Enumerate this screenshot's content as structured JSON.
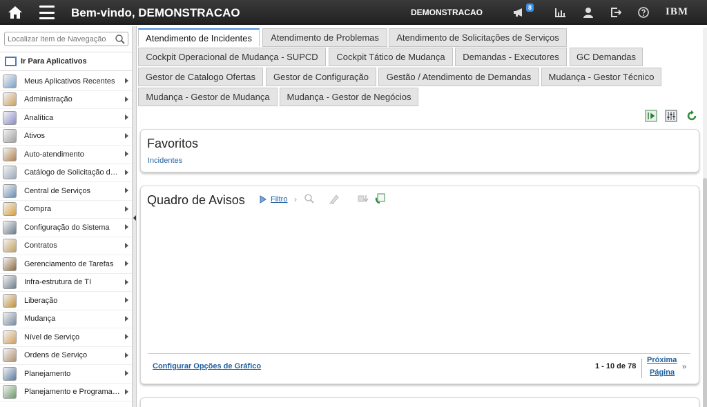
{
  "header": {
    "title": "Bem-vindo, DEMONSTRACAO",
    "user": "DEMONSTRACAO",
    "notification_count": "8",
    "brand": "IBM"
  },
  "leftnav": {
    "search_placeholder": "Localizar Item de Navegação",
    "goto_label": "Ir Para Aplicativos",
    "items": [
      {
        "label": "Meus Aplicativos Recentes",
        "icon": "recent-apps-icon"
      },
      {
        "label": "Administração",
        "icon": "administration-icon"
      },
      {
        "label": "Analítica",
        "icon": "analytics-icon"
      },
      {
        "label": "Ativos",
        "icon": "assets-icon"
      },
      {
        "label": "Auto-atendimento",
        "icon": "self-service-icon"
      },
      {
        "label": "Catálogo de Solicitação de Serviços",
        "icon": "service-catalog-icon"
      },
      {
        "label": "Central de Serviços",
        "icon": "service-desk-icon"
      },
      {
        "label": "Compra",
        "icon": "purchasing-icon"
      },
      {
        "label": "Configuração do Sistema",
        "icon": "system-config-icon"
      },
      {
        "label": "Contratos",
        "icon": "contracts-icon"
      },
      {
        "label": "Gerenciamento de Tarefas",
        "icon": "task-management-icon"
      },
      {
        "label": "Infra-estrutura de TI",
        "icon": "it-infrastructure-icon"
      },
      {
        "label": "Liberação",
        "icon": "release-icon"
      },
      {
        "label": "Mudança",
        "icon": "change-icon"
      },
      {
        "label": "Nível de Serviço",
        "icon": "service-level-icon"
      },
      {
        "label": "Ordens de Serviço",
        "icon": "work-orders-icon"
      },
      {
        "label": "Planejamento",
        "icon": "planning-icon"
      },
      {
        "label": "Planejamento e Programação",
        "icon": "planning-scheduling-icon"
      }
    ]
  },
  "tabs": [
    {
      "label": "Atendimento de Incidentes",
      "active": true
    },
    {
      "label": "Atendimento de Problemas"
    },
    {
      "label": "Atendimento de Solicitações de Serviços"
    },
    {
      "label": "Cockpit Operacional de Mudança - SUPCD"
    },
    {
      "label": "Cockpit Tático de Mudança"
    },
    {
      "label": "Demandas - Executores"
    },
    {
      "label": "GC Demandas"
    },
    {
      "label": "Gestor de Catalogo Ofertas"
    },
    {
      "label": "Gestor de Configuração"
    },
    {
      "label": "Gestão / Atendimento de Demandas"
    },
    {
      "label": "Mudança - Gestor Técnico"
    },
    {
      "label": "Mudança - Gestor de Mudança"
    },
    {
      "label": "Mudança - Gestor de Negócios"
    }
  ],
  "favorites": {
    "title": "Favoritos",
    "link": "Incidentes"
  },
  "bulletin": {
    "title": "Quadro de Avisos",
    "filter_label": "Filtro",
    "config_link": "Configurar Opções de Gráfico",
    "pager": "1 - 10 de 78",
    "next_line1": "Próxima",
    "next_line2": "Página",
    "next_arrows": "»"
  },
  "colors": {
    "accent": "#4a90d9",
    "link": "#1f5f9f",
    "topbar": "#2b2b2b"
  }
}
